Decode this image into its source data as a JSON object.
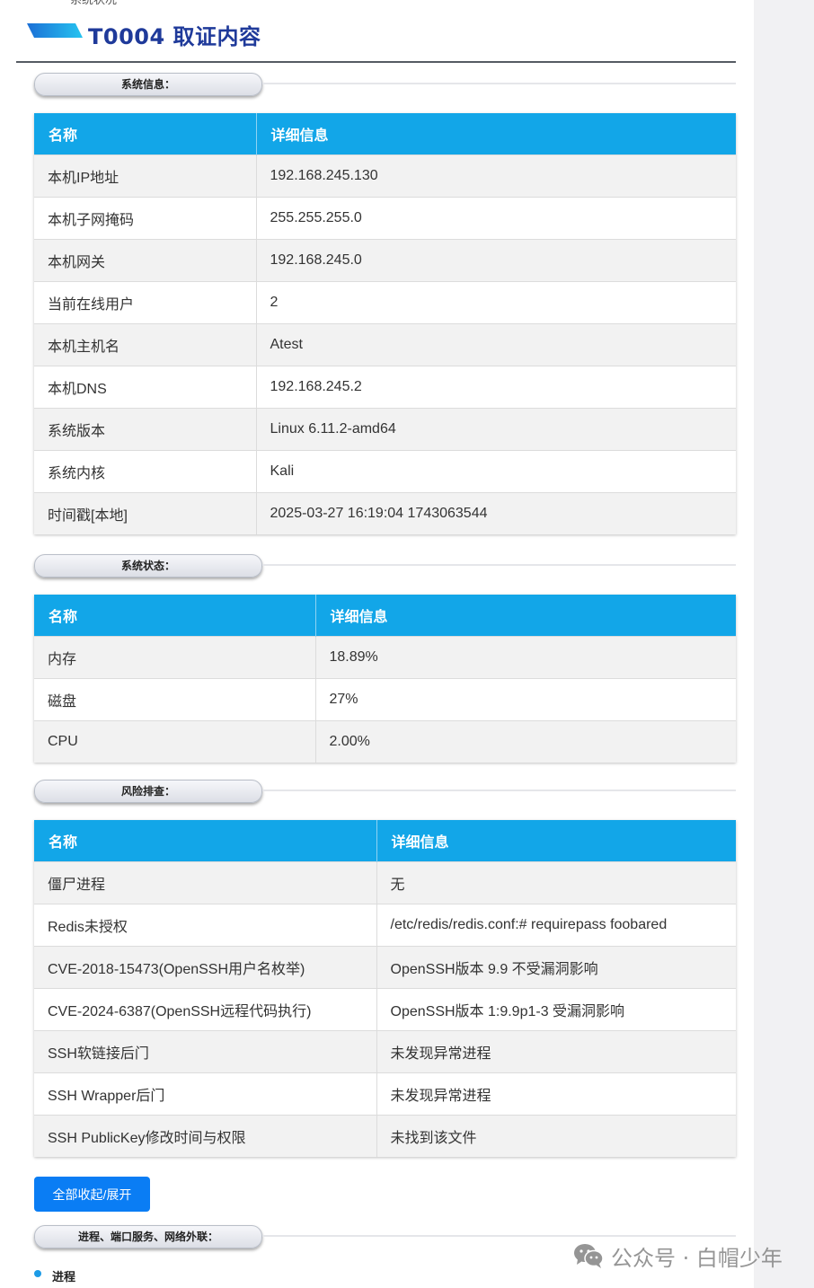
{
  "cut_text": "系统状况",
  "page_title": "T0004 取证内容",
  "sections": {
    "system_info": {
      "label": "系统信息："
    },
    "system_status": {
      "label": "系统状态："
    },
    "risk_check": {
      "label": "风险排查："
    },
    "process": {
      "label": "进程、端口服务、网络外联："
    }
  },
  "tables": {
    "system_info": {
      "headers": [
        "名称",
        "详细信息"
      ],
      "rows": [
        [
          "本机IP地址",
          "192.168.245.130"
        ],
        [
          "本机子网掩码",
          "255.255.255.0"
        ],
        [
          "本机网关",
          "192.168.245.0"
        ],
        [
          "当前在线用户",
          "2"
        ],
        [
          "本机主机名",
          "Atest"
        ],
        [
          "本机DNS",
          "192.168.245.2"
        ],
        [
          "系统版本",
          "Linux 6.11.2-amd64"
        ],
        [
          "系统内核",
          "Kali"
        ],
        [
          "时间戳[本地]",
          "2025-03-27 16:19:04 1743063544"
        ]
      ]
    },
    "system_status": {
      "headers": [
        "名称",
        "详细信息"
      ],
      "rows": [
        [
          "内存",
          "18.89%"
        ],
        [
          "磁盘",
          "27%"
        ],
        [
          "CPU",
          "2.00%"
        ]
      ]
    },
    "risk_check": {
      "headers": [
        "名称",
        "详细信息"
      ],
      "rows": [
        [
          "僵尸进程",
          "无"
        ],
        [
          "Redis未授权",
          "/etc/redis/redis.conf:# requirepass foobared"
        ],
        [
          "CVE-2018-15473(OpenSSH用户名枚举)",
          "OpenSSH版本 9.9 不受漏洞影响"
        ],
        [
          "CVE-2024-6387(OpenSSH远程代码执行)",
          "OpenSSH版本 1:9.9p1-3 受漏洞影响"
        ],
        [
          "SSH软链接后门",
          "未发现异常进程"
        ],
        [
          "SSH Wrapper后门",
          "未发现异常进程"
        ],
        [
          "SSH PublicKey修改时间与权限",
          "未找到该文件"
        ]
      ]
    }
  },
  "toggle_button": "全部收起/展开",
  "process_item": "进程",
  "watermark": "公众号 · 白帽少年",
  "colors": {
    "header_blue": "#12a6e8",
    "button_blue": "#0a7df4",
    "title_blue": "#1f3a9a"
  },
  "icons": {
    "watermark": "wechat-icon",
    "header": "header-stripe"
  }
}
